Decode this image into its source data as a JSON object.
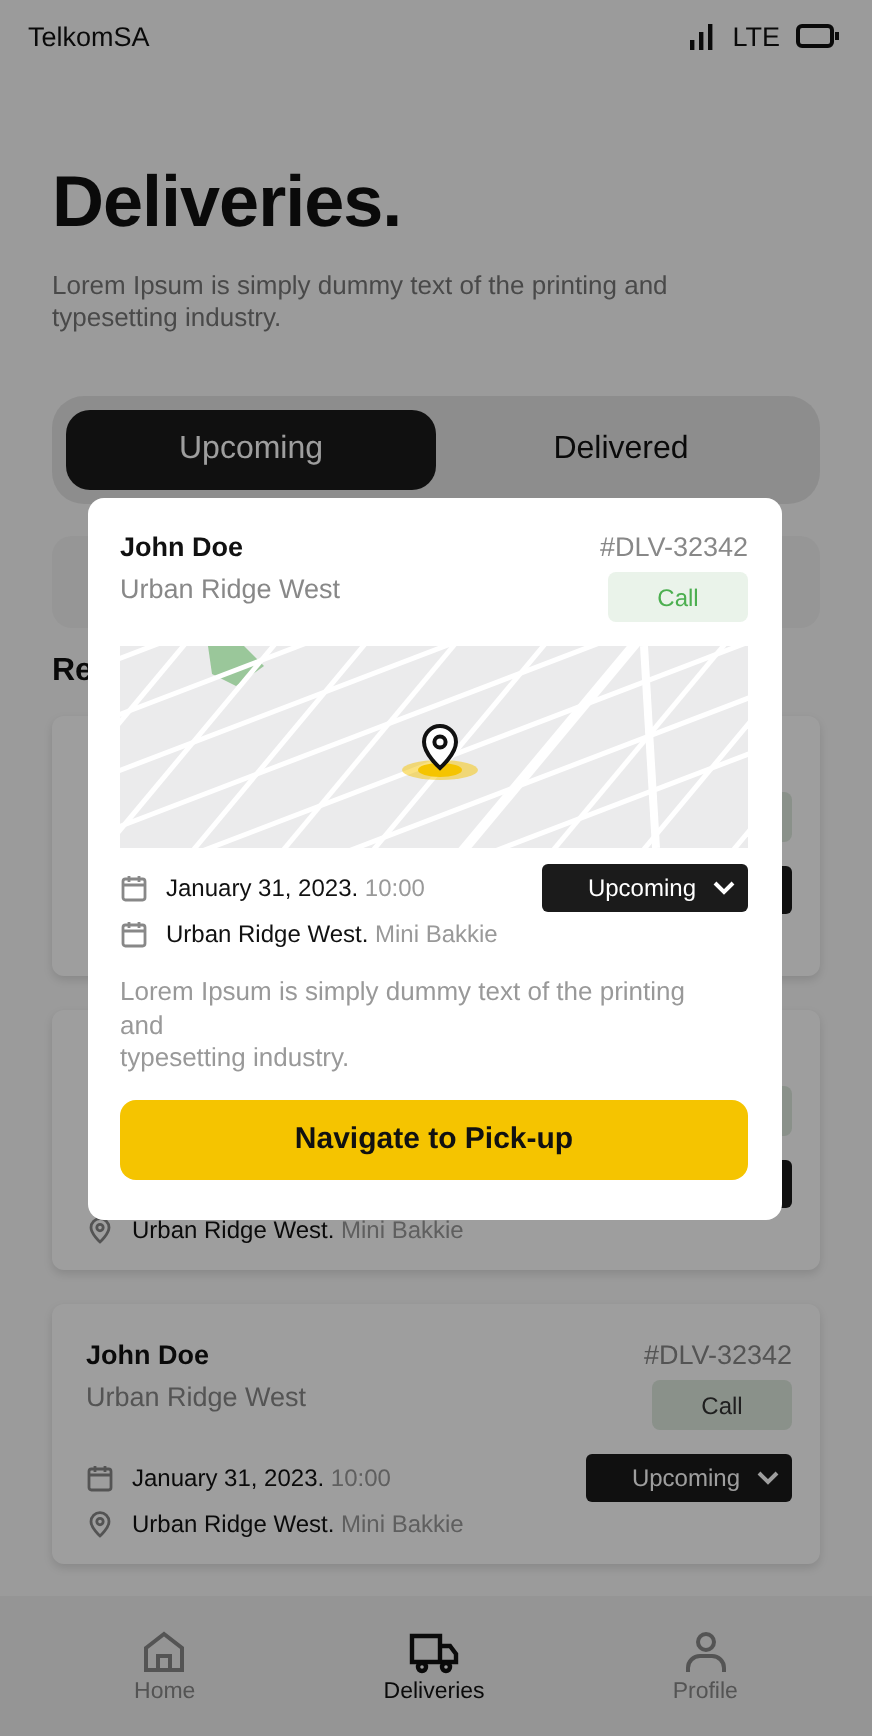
{
  "status_bar": {
    "carrier": "TelkomSA",
    "network": "LTE"
  },
  "title": "Deliveries.",
  "subtitle": "Lorem Ipsum is simply dummy text of the printing and typesetting industry.",
  "tabs": [
    {
      "label": "Upcoming",
      "selected": true
    },
    {
      "label": "Delivered",
      "selected": false
    }
  ],
  "section_title": "Re",
  "cards": [
    {
      "kind": "delivery"
    },
    {
      "kind": "delivery",
      "place": "Urban Ridge West.",
      "vehicle": "Mini Bakkie"
    },
    {
      "kind": "delivery",
      "name": "John Doe",
      "area": "Urban Ridge West",
      "id": "#DLV-32342",
      "call": "Call",
      "date": "January 31, 2023.",
      "time": "10:00",
      "status": "Upcoming",
      "place": "Urban Ridge West.",
      "vehicle": "Mini Bakkie"
    }
  ],
  "modal": {
    "name": "John Doe",
    "area": "Urban Ridge West",
    "id": "#DLV-32342",
    "call": "Call",
    "date": "January 31, 2023.",
    "time": "10:00",
    "status": "Upcoming",
    "place": "Urban Ridge West.",
    "vehicle": "Mini Bakkie",
    "description": "Lorem Ipsum is simply dummy text of the printing and\ntypesetting industry.",
    "action": "Navigate to Pick-up"
  },
  "nav": [
    {
      "label": "Home",
      "selected": false
    },
    {
      "label": "Deliveries",
      "selected": true
    },
    {
      "label": "Profile",
      "selected": false
    }
  ]
}
